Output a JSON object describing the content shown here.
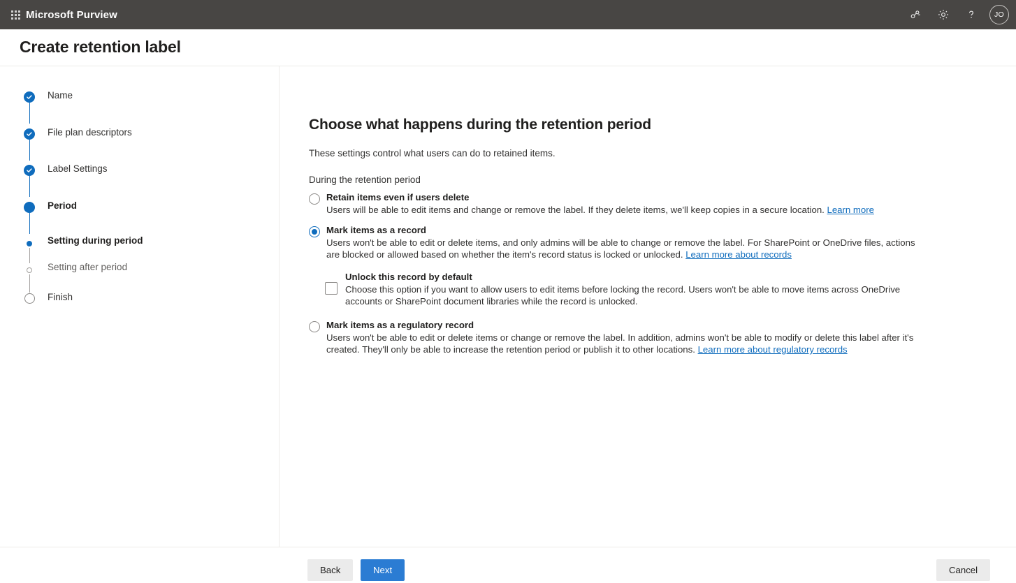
{
  "suite": {
    "waffle_icon": "app-launcher-grid-icon",
    "title": "Microsoft Purview",
    "icons": [
      {
        "name": "diagnostics-icon",
        "glyph": "diagnostics"
      },
      {
        "name": "settings-gear-icon",
        "glyph": "gear"
      },
      {
        "name": "help-icon",
        "glyph": "question-mark"
      }
    ],
    "avatar_initials": "JO",
    "bar_color": "#484644"
  },
  "page": {
    "title": "Create retention label"
  },
  "wizard": {
    "steps": [
      {
        "label": "Name",
        "state": "done",
        "type": "major"
      },
      {
        "label": "File plan descriptors",
        "state": "done",
        "type": "major"
      },
      {
        "label": "Label Settings",
        "state": "done",
        "type": "major"
      },
      {
        "label": "Period",
        "state": "current",
        "type": "major"
      },
      {
        "label": "Setting during period",
        "state": "active",
        "type": "sub"
      },
      {
        "label": "Setting after period",
        "state": "idle",
        "type": "sub"
      },
      {
        "label": "Finish",
        "state": "idle",
        "type": "major"
      }
    ],
    "accent_color": "#0f6cbd",
    "idle_color": "#a19f9d"
  },
  "main": {
    "heading": "Choose what happens during the retention period",
    "subheading": "These settings control what users can do to retained items.",
    "group_label": "During the retention period",
    "options": [
      {
        "id": "retain-items",
        "title": "Retain items even if users delete",
        "desc": "Users will be able to edit items and change or remove the label. If they delete items, we'll keep copies in a secure location.",
        "link": "Learn more",
        "selected": false
      },
      {
        "id": "mark-as-record",
        "title": "Mark items as a record",
        "desc": "Users won't be able to edit or delete items, and only admins will be able to change or remove the label. For SharePoint or OneDrive files, actions are blocked or allowed based on whether the item's record status is locked or unlocked.",
        "link": "Learn more about records",
        "selected": true
      },
      {
        "id": "mark-as-regulatory-record",
        "title": "Mark items as a regulatory record",
        "desc": "Users won't be able to edit or delete items or change or remove the label. In addition, admins won't be able to modify or delete this label after it's created. They'll only be able to increase the retention period or publish it to other locations.",
        "link": "Learn more about regulatory records",
        "selected": false
      }
    ],
    "sub_option": {
      "id": "unlock-record-by-default",
      "title": "Unlock this record by default",
      "desc": "Choose this option if you want to allow users to edit items before locking the record. Users won't be able to move items across OneDrive accounts or SharePoint document libraries while the record is unlocked.",
      "checked": false
    }
  },
  "footer": {
    "back_label": "Back",
    "next_label": "Next",
    "cancel_label": "Cancel",
    "primary_color": "#2b7cd3"
  }
}
